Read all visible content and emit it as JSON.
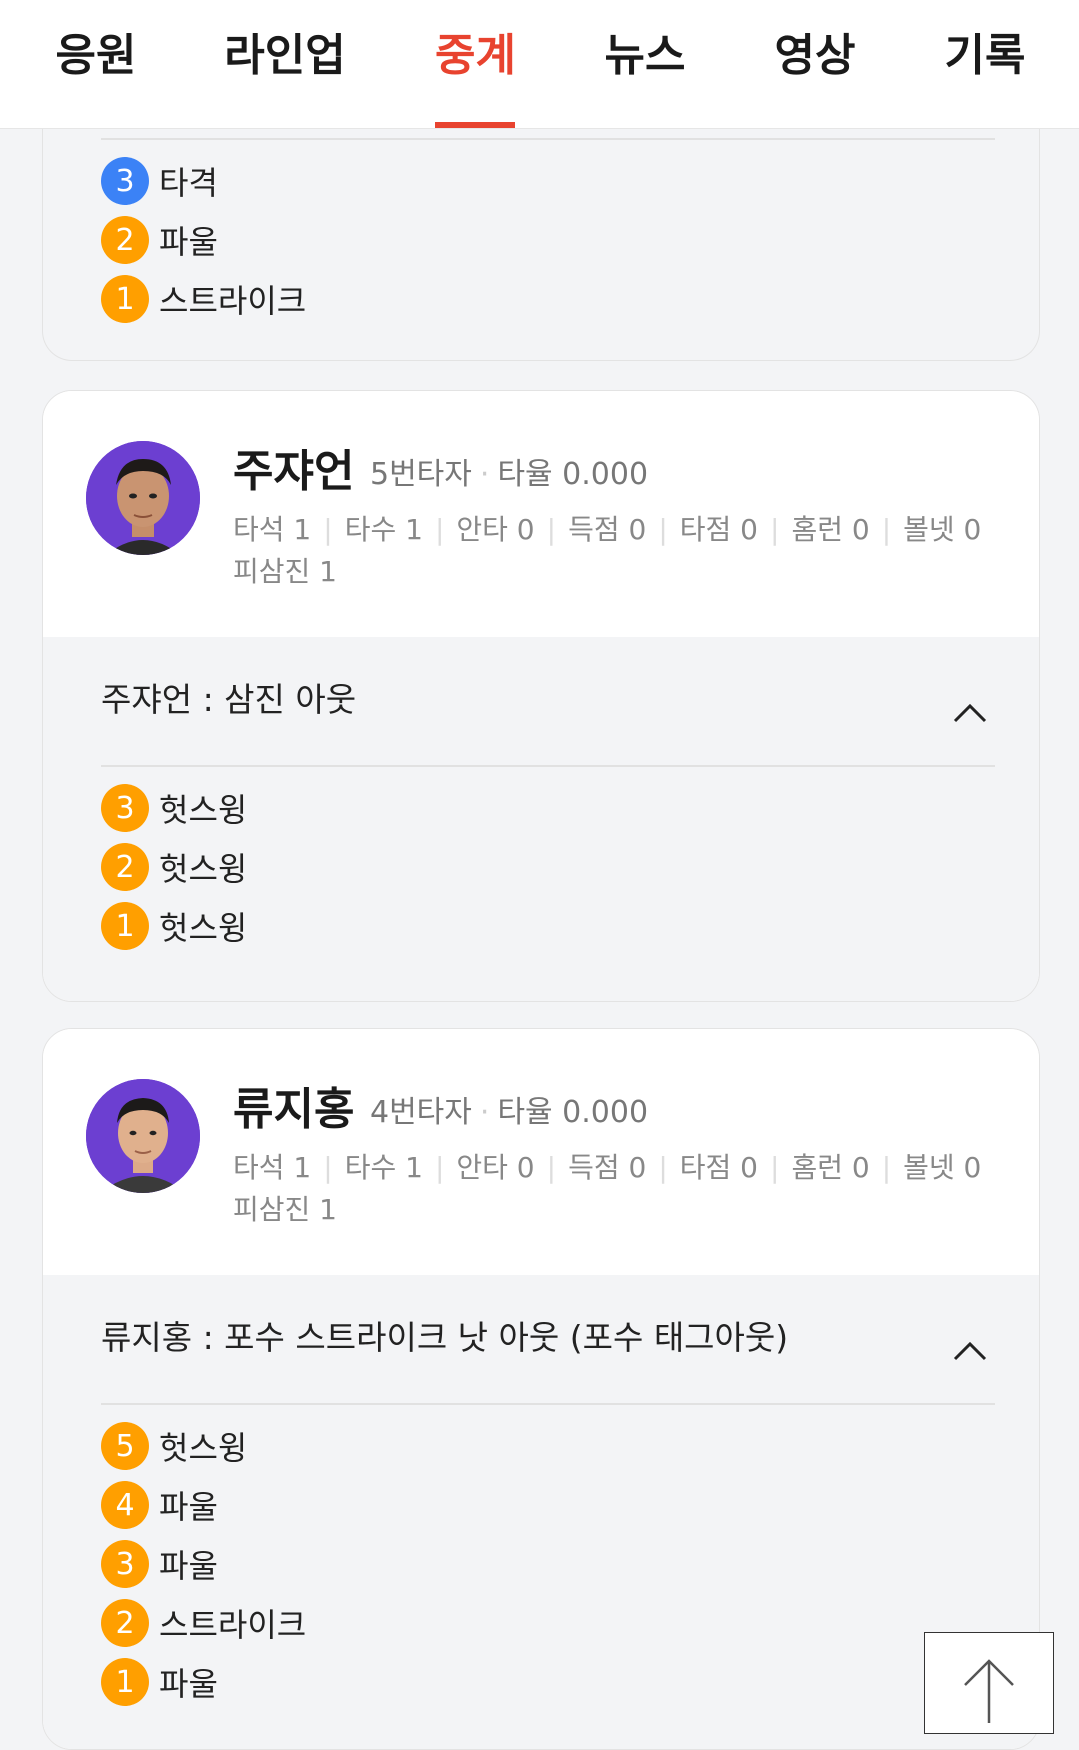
{
  "tabs": [
    {
      "label": "응원",
      "active": false
    },
    {
      "label": "라인업",
      "active": false
    },
    {
      "label": "중계",
      "active": true
    },
    {
      "label": "뉴스",
      "active": false
    },
    {
      "label": "영상",
      "active": false
    },
    {
      "label": "기록",
      "active": false
    }
  ],
  "colors": {
    "accent": "#e8432f",
    "ball_orange": "#ff9f00",
    "ball_blue": "#3b82f6"
  },
  "previous_play": {
    "pitches": [
      {
        "num": "3",
        "label": "타격",
        "color": "blue"
      },
      {
        "num": "2",
        "label": "파울",
        "color": "orange"
      },
      {
        "num": "1",
        "label": "스트라이크",
        "color": "orange"
      }
    ]
  },
  "batters": [
    {
      "name": "주쟈언",
      "order": "5번타자",
      "avg": "타율 0.000",
      "stats": [
        "타석 1",
        "타수 1",
        "안타 0",
        "득점 0",
        "타점 0",
        "홈런 0",
        "볼넷 0",
        "피삼진 1"
      ],
      "result": "주쟈언 : 삼진 아웃",
      "pitches": [
        {
          "num": "3",
          "label": "헛스윙",
          "color": "orange"
        },
        {
          "num": "2",
          "label": "헛스윙",
          "color": "orange"
        },
        {
          "num": "1",
          "label": "헛스윙",
          "color": "orange"
        }
      ]
    },
    {
      "name": "류지홍",
      "order": "4번타자",
      "avg": "타율 0.000",
      "stats": [
        "타석 1",
        "타수 1",
        "안타 0",
        "득점 0",
        "타점 0",
        "홈런 0",
        "볼넷 0",
        "피삼진 1"
      ],
      "result": "류지홍 : 포수 스트라이크 낫 아웃 (포수 태그아웃)",
      "pitches": [
        {
          "num": "5",
          "label": "헛스윙",
          "color": "orange"
        },
        {
          "num": "4",
          "label": "파울",
          "color": "orange"
        },
        {
          "num": "3",
          "label": "파울",
          "color": "orange"
        },
        {
          "num": "2",
          "label": "스트라이크",
          "color": "orange"
        },
        {
          "num": "1",
          "label": "파울",
          "color": "orange"
        }
      ]
    }
  ]
}
